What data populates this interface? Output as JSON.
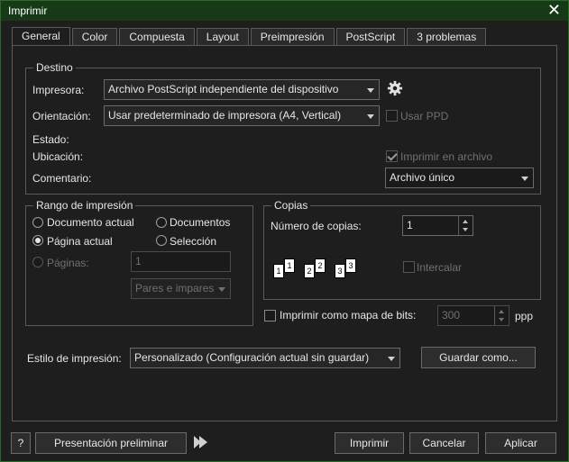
{
  "window": {
    "title": "Imprimir",
    "close_glyph": "✕"
  },
  "tabs": [
    {
      "label": "General"
    },
    {
      "label": "Color"
    },
    {
      "label": "Compuesta"
    },
    {
      "label": "Layout"
    },
    {
      "label": "Preimpresión"
    },
    {
      "label": "PostScript"
    },
    {
      "label": "3 problemas"
    }
  ],
  "destino": {
    "legend": "Destino",
    "impresora_label": "Impresora:",
    "impresora_value": "Archivo PostScript independiente del dispositivo",
    "orientacion_label": "Orientación:",
    "orientacion_value": "Usar predeterminado de impresora (A4, Vertical)",
    "usar_ppd_label": "Usar PPD",
    "estado_label": "Estado:",
    "ubicacion_label": "Ubicación:",
    "imprimir_archivo_label": "Imprimir en archivo",
    "comentario_label": "Comentario:",
    "archivo_value": "Archivo único"
  },
  "rango": {
    "legend": "Rango de impresión",
    "documento_actual": "Documento actual",
    "documentos": "Documentos",
    "pagina_actual": "Página actual",
    "seleccion": "Selección",
    "paginas_label": "Páginas:",
    "paginas_value": "1",
    "pares_value": "Pares e impares"
  },
  "copias": {
    "legend": "Copias",
    "numero_label": "Número de copias:",
    "numero_value": "1",
    "intercalar_label": "Intercalar",
    "page_glyphs": [
      "1",
      "1",
      "2",
      "2",
      "3",
      "3"
    ]
  },
  "bitmap": {
    "label": "Imprimir como mapa de bits:",
    "value": "300",
    "unit": "ppp"
  },
  "estilo": {
    "label": "Estilo de impresión:",
    "value": "Personalizado (Configuración actual sin guardar)",
    "guardar_label": "Guardar como..."
  },
  "footer": {
    "help_label": "?",
    "preview_label": "Presentación preliminar",
    "print_label": "Imprimir",
    "cancel_label": "Cancelar",
    "apply_label": "Aplicar"
  },
  "colors": {
    "accent": "#163a16",
    "background": "#1e1e1e"
  }
}
